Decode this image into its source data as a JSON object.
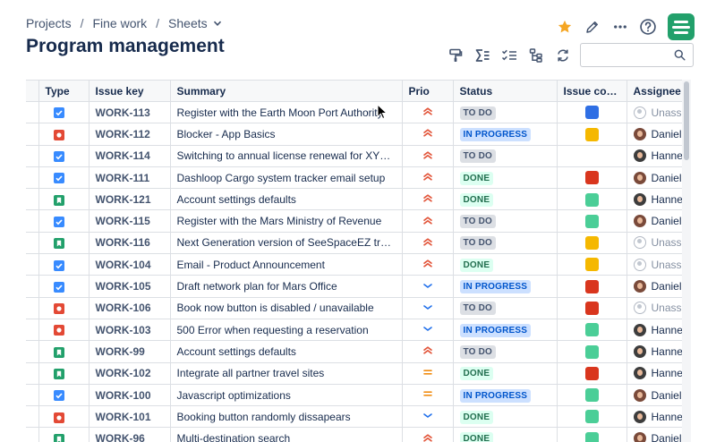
{
  "breadcrumb": {
    "items": [
      "Projects",
      "Fine work",
      "Sheets"
    ],
    "separator": "/"
  },
  "page_title": "Program management",
  "header_icons": [
    "star-icon",
    "pencil-icon",
    "more-icon",
    "help-icon",
    "app-logo-icon"
  ],
  "toolbar_icons": [
    "format-paint-icon",
    "sum-icon",
    "checklist-icon",
    "hierarchy-icon",
    "refresh-icon"
  ],
  "search": {
    "value": "",
    "placeholder": ""
  },
  "colors": {
    "todo_bg": "#dcdfe4",
    "progress_bg": "#cce0ff",
    "done_bg": "#dcfff1",
    "swatch_blue": "#2f6fe4",
    "swatch_yellow": "#f5b800",
    "swatch_red": "#d9361e",
    "swatch_green": "#4bce97",
    "priority_high": "#e2553a",
    "priority_low": "#1f6feb",
    "priority_medium": "#f18d13"
  },
  "table": {
    "columns": [
      "Type",
      "Issue key",
      "Summary",
      "Prio",
      "Status",
      "Issue color",
      "Assignee"
    ],
    "rows": [
      {
        "type": "task",
        "key": "WORK-113",
        "summary": "Register with the Earth Moon Port Authority",
        "prio": "high",
        "status": "TO DO",
        "color": "blue",
        "assignee": "Unassigned"
      },
      {
        "type": "bug",
        "key": "WORK-112",
        "summary": "Blocker - App Basics",
        "prio": "high",
        "status": "IN PROGRESS",
        "color": "yellow",
        "assignee": "Daniel"
      },
      {
        "type": "task",
        "key": "WORK-114",
        "summary": "Switching to annual license renewal for XYZ ...",
        "prio": "high",
        "status": "TO DO",
        "color": "",
        "assignee": "Hanne"
      },
      {
        "type": "task",
        "key": "WORK-111",
        "summary": "Dashloop Cargo system tracker email setup",
        "prio": "high",
        "status": "DONE",
        "color": "red",
        "assignee": "Daniel"
      },
      {
        "type": "story",
        "key": "WORK-121",
        "summary": "Account settings defaults",
        "prio": "high",
        "status": "DONE",
        "color": "green",
        "assignee": "Hanne"
      },
      {
        "type": "task",
        "key": "WORK-115",
        "summary": "Register with the Mars Ministry of Revenue",
        "prio": "high",
        "status": "TO DO",
        "color": "green",
        "assignee": "Daniel"
      },
      {
        "type": "story",
        "key": "WORK-116",
        "summary": "Next Generation version of SeeSpaceEZ trav...",
        "prio": "high",
        "status": "TO DO",
        "color": "yellow",
        "assignee": "Unassigned"
      },
      {
        "type": "task",
        "key": "WORK-104",
        "summary": "Email - Product Announcement",
        "prio": "high",
        "status": "DONE",
        "color": "yellow",
        "assignee": "Unassigned"
      },
      {
        "type": "task",
        "key": "WORK-105",
        "summary": "Draft network plan for Mars Office",
        "prio": "low",
        "status": "IN PROGRESS",
        "color": "red",
        "assignee": "Daniel"
      },
      {
        "type": "bug",
        "key": "WORK-106",
        "summary": "Book now button is disabled / unavailable",
        "prio": "low",
        "status": "TO DO",
        "color": "red",
        "assignee": "Unassigned"
      },
      {
        "type": "bug",
        "key": "WORK-103",
        "summary": "500 Error when requesting a reservation",
        "prio": "low",
        "status": "IN PROGRESS",
        "color": "green",
        "assignee": "Hanne"
      },
      {
        "type": "story",
        "key": "WORK-99",
        "summary": "Account settings defaults",
        "prio": "high",
        "status": "TO DO",
        "color": "green",
        "assignee": "Hanne"
      },
      {
        "type": "story",
        "key": "WORK-102",
        "summary": "Integrate all partner travel sites",
        "prio": "medium",
        "status": "DONE",
        "color": "red",
        "assignee": "Hanne"
      },
      {
        "type": "task",
        "key": "WORK-100",
        "summary": "Javascript optimizations",
        "prio": "medium",
        "status": "IN PROGRESS",
        "color": "green",
        "assignee": "Daniel"
      },
      {
        "type": "bug",
        "key": "WORK-101",
        "summary": "Booking button randomly dissapears",
        "prio": "low",
        "status": "DONE",
        "color": "green",
        "assignee": "Hanne"
      },
      {
        "type": "story",
        "key": "WORK-96",
        "summary": "Multi-destination search",
        "prio": "high",
        "status": "DONE",
        "color": "green",
        "assignee": "Daniel"
      }
    ]
  }
}
